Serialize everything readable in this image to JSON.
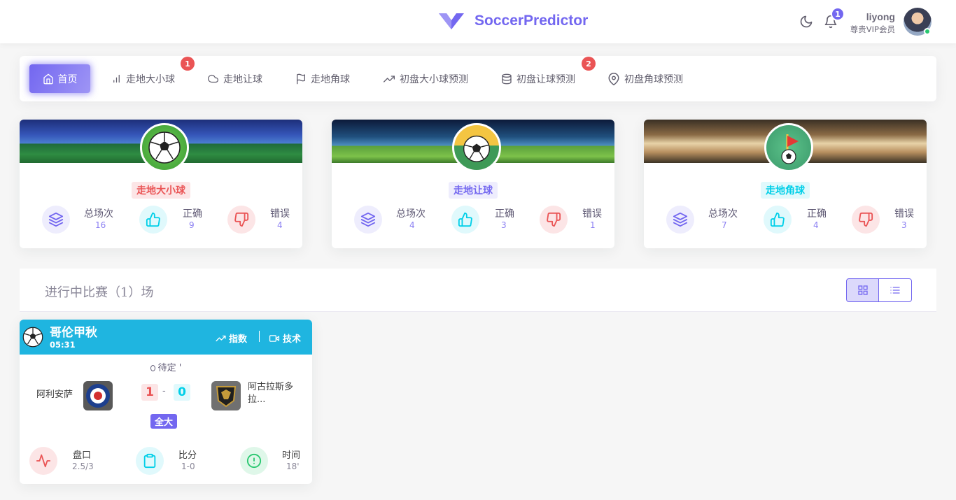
{
  "brand": {
    "name": "SoccerPredictor",
    "color": "#7367f0"
  },
  "header": {
    "notification_count": "1",
    "username": "liyong",
    "role": "尊贵VIP会员",
    "icons": [
      "moon-icon",
      "bell-icon"
    ]
  },
  "nav": {
    "items": [
      {
        "label": "首页",
        "icon": "home-icon",
        "active": true
      },
      {
        "label": "走地大小球",
        "icon": "bar-chart-icon",
        "badge": "1"
      },
      {
        "label": "走地让球",
        "icon": "cloud-icon"
      },
      {
        "label": "走地角球",
        "icon": "flag-icon"
      },
      {
        "label": "初盘大小球预测",
        "icon": "trending-up-icon"
      },
      {
        "label": "初盘让球预测",
        "icon": "database-icon",
        "badge": "2"
      },
      {
        "label": "初盘角球预测",
        "icon": "map-pin-icon"
      }
    ]
  },
  "stat_cards": [
    {
      "title": "走地大小球",
      "total_label": "总场次",
      "total": "16",
      "correct_label": "正确",
      "correct": "9",
      "wrong_label": "错误",
      "wrong": "4"
    },
    {
      "title": "走地让球",
      "total_label": "总场次",
      "total": "4",
      "correct_label": "正确",
      "correct": "3",
      "wrong_label": "错误",
      "wrong": "1"
    },
    {
      "title": "走地角球",
      "total_label": "总场次",
      "total": "7",
      "correct_label": "正确",
      "correct": "4",
      "wrong_label": "错误",
      "wrong": "3"
    }
  ],
  "live": {
    "title": "进行中比赛（1）场",
    "view_modes": [
      "grid-icon",
      "list-icon"
    ]
  },
  "match": {
    "league": "哥伦甲秋",
    "time": "05:31",
    "action_index": "指数",
    "action_tech": "技术",
    "status": "待定 '",
    "home": "阿利安萨",
    "away": "阿古拉斯多拉...",
    "home_score": "1",
    "separator": "-",
    "away_score": "0",
    "tag": "全大",
    "handicap_label": "盘口",
    "handicap": "2.5/3",
    "score_label": "比分",
    "score": "1-0",
    "time_label": "时间",
    "minute": "18'"
  },
  "colors": {
    "accent": "#7367f0",
    "danger": "#ea5455",
    "info": "#00cfe8",
    "success": "#28c76f",
    "match_header": "#1fb5e0"
  }
}
